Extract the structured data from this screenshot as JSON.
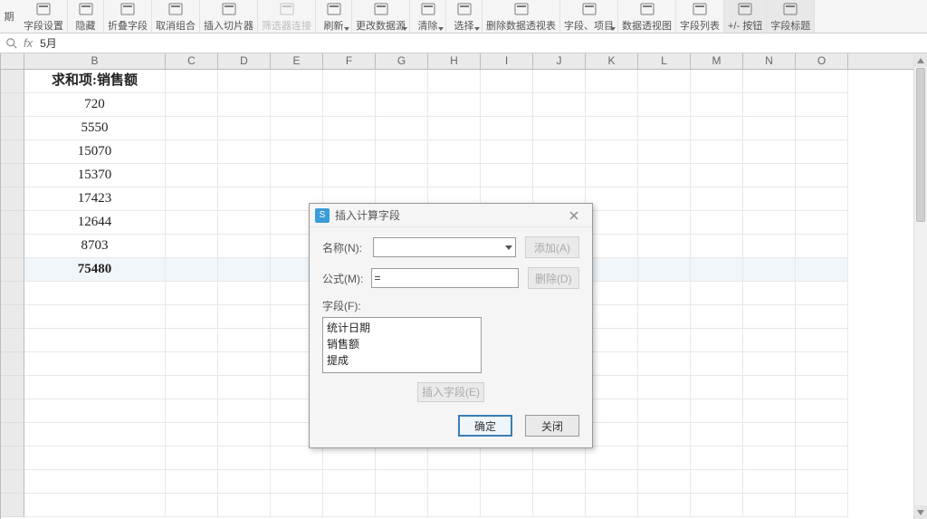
{
  "ribbon": {
    "left_label": "期",
    "items": [
      {
        "label": "字段设置"
      },
      {
        "label": "隐藏"
      },
      {
        "label": "折叠字段"
      },
      {
        "label": "取消组合"
      },
      {
        "label": "插入切片器"
      },
      {
        "label": "筛选器连接",
        "disabled": true
      },
      {
        "label": "刷新",
        "drop": true
      },
      {
        "label": "更改数据源",
        "drop": true
      },
      {
        "label": "清除",
        "drop": true
      },
      {
        "label": "选择",
        "drop": true
      },
      {
        "label": "删除数据透视表"
      },
      {
        "label": "字段、项目",
        "drop": true
      },
      {
        "label": "数据透视图"
      },
      {
        "label": "字段列表"
      },
      {
        "label": "+/- 按钮",
        "sel": true
      },
      {
        "label": "字段标题",
        "sel": true
      }
    ]
  },
  "formula_bar": {
    "value": "5月"
  },
  "columns": [
    "B",
    "C",
    "D",
    "E",
    "F",
    "G",
    "H",
    "I",
    "J",
    "K",
    "L",
    "M",
    "N",
    "O"
  ],
  "rows": [
    {
      "b": "求和项:销售额",
      "header": true
    },
    {
      "b": "720"
    },
    {
      "b": "5550"
    },
    {
      "b": "15070"
    },
    {
      "b": "15370"
    },
    {
      "b": "17423"
    },
    {
      "b": "12644"
    },
    {
      "b": "8703"
    },
    {
      "b": "75480",
      "total": true
    }
  ],
  "dialog": {
    "title": "插入计算字段",
    "name_label": "名称(N):",
    "name_value": "",
    "formula_label": "公式(M):",
    "formula_value": "=",
    "add_btn": "添加(A)",
    "del_btn": "删除(D)",
    "fields_label": "字段(F):",
    "fields": [
      "统计日期",
      "销售额",
      "提成"
    ],
    "insert_btn": "插入字段(E)",
    "ok": "确定",
    "close": "关闭"
  }
}
